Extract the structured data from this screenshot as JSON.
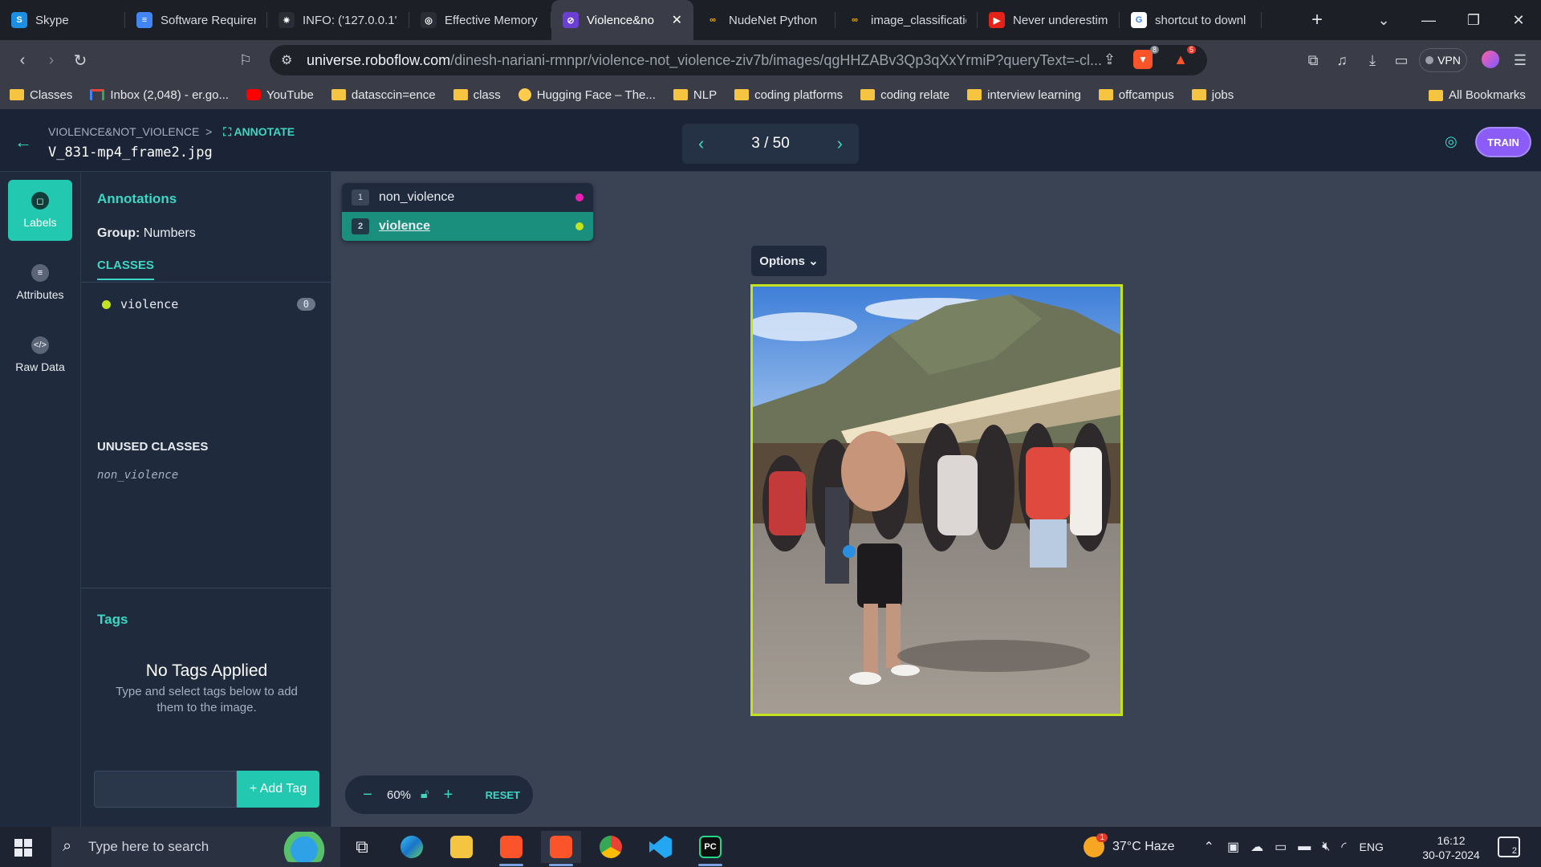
{
  "browser": {
    "tabs": [
      {
        "label": "Skype",
        "icon": "skype-icon",
        "color": "#1a8fe3",
        "glyph": "S"
      },
      {
        "label": "Software Requiren",
        "icon": "docs-icon",
        "color": "#4285f4",
        "glyph": "≡"
      },
      {
        "label": "INFO: ('127.0.0.1',",
        "icon": "sparkle-icon",
        "color": "#2a2d35",
        "glyph": "✷"
      },
      {
        "label": "Effective Memory",
        "icon": "openai-icon",
        "color": "#2a2d35",
        "glyph": "◎"
      },
      {
        "label": "Violence&no",
        "icon": "roboflow-icon",
        "color": "#6b3fd4",
        "glyph": "⊘",
        "active": true
      },
      {
        "label": "NudeNet Python",
        "icon": "colab-icon",
        "color": "#1c1f26",
        "glyph": "∞"
      },
      {
        "label": "image_classificatio",
        "icon": "colab-icon",
        "color": "#1c1f26",
        "glyph": "∞"
      },
      {
        "label": "Never underestim",
        "icon": "youtube-icon",
        "color": "#e62117",
        "glyph": "▶"
      },
      {
        "label": "shortcut to downl",
        "icon": "google-icon",
        "color": "#ffffff",
        "glyph": "G"
      }
    ],
    "new_tab": "+",
    "url_host": "universe.roboflow.com",
    "url_path": "/dinesh-nariani-rmnpr/violence-not_violence-ziv7b/images/qgHHZABv3Qp3qXxYrmiP?queryText=-cl...",
    "vpn_label": "VPN",
    "brave_badge": "8",
    "alert_badge": "5",
    "bookmarks": [
      {
        "label": "Classes",
        "type": "classroom"
      },
      {
        "label": "Inbox (2,048) - er.go...",
        "type": "gmail"
      },
      {
        "label": "YouTube",
        "type": "youtube"
      },
      {
        "label": "datasccin=ence",
        "type": "folder"
      },
      {
        "label": "class",
        "type": "folder"
      },
      {
        "label": "Hugging Face – The...",
        "type": "huggingface"
      },
      {
        "label": "NLP",
        "type": "folder"
      },
      {
        "label": "coding platforms",
        "type": "folder"
      },
      {
        "label": "coding relate",
        "type": "folder"
      },
      {
        "label": "interview learning",
        "type": "folder"
      },
      {
        "label": "offcampus",
        "type": "folder"
      },
      {
        "label": "jobs",
        "type": "folder"
      }
    ],
    "all_bookmarks": "All Bookmarks"
  },
  "header": {
    "breadcrumb_project": "VIOLENCE&NOT_VIOLENCE",
    "breadcrumb_sep": ">",
    "breadcrumb_mode": "ANNOTATE",
    "filename": "V_831-mp4_frame2.jpg",
    "pager": "3 / 50",
    "train_label": "TRAIN"
  },
  "rail": {
    "items": [
      {
        "label": "Labels",
        "icon": "label-icon"
      },
      {
        "label": "Attributes",
        "icon": "list-icon"
      },
      {
        "label": "Raw Data",
        "icon": "code-icon"
      }
    ]
  },
  "panel": {
    "title": "Annotations",
    "group_label": "Group:",
    "group_value": "Numbers",
    "classes_tab": "CLASSES",
    "class_name": "violence",
    "class_count": "0",
    "unused_title": "UNUSED CLASSES",
    "unused_item": "non_violence",
    "tags_title": "Tags",
    "no_tags": "No Tags Applied",
    "no_tags_sub": "Type and select tags below to add them to the image.",
    "add_tag": "+ Add Tag"
  },
  "canvas": {
    "class_list": [
      {
        "num": "1",
        "label": "non_violence",
        "color": "#e91eb4"
      },
      {
        "num": "2",
        "label": "violence",
        "color": "#c4e31e",
        "selected": true
      }
    ],
    "options_label": "Options ⌄",
    "zoom_minus": "−",
    "zoom_value": "60%",
    "zoom_plus": "+",
    "reset_label": "RESET",
    "bbox_color": "#c4e31e"
  },
  "taskbar": {
    "search_placeholder": "Type here to search",
    "weather": "37°C  Haze",
    "weather_badge": "1",
    "lang": "ENG",
    "time": "16:12",
    "date": "30-07-2024",
    "notif_count": "2"
  }
}
